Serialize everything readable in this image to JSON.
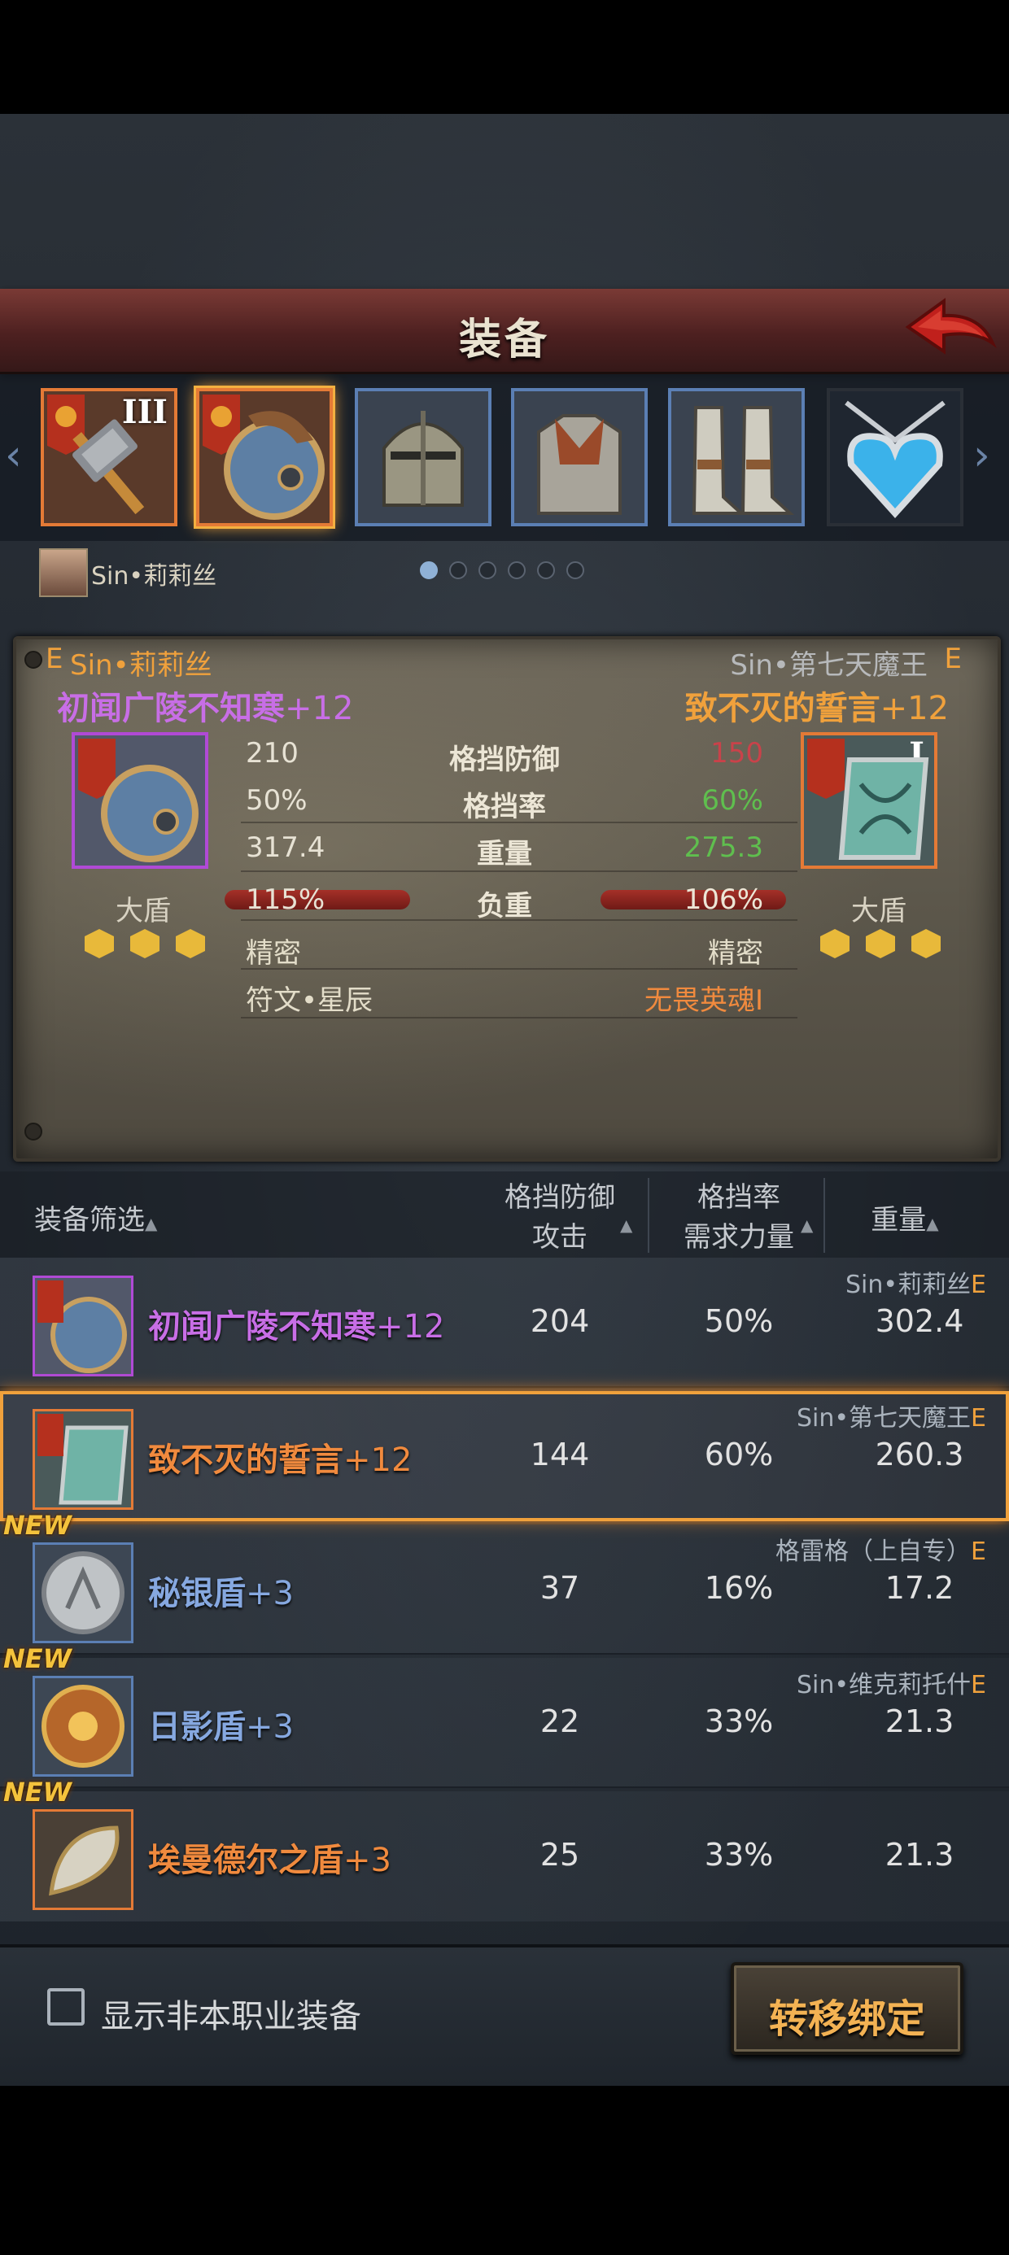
{
  "header": {
    "title": "装备"
  },
  "slots": [
    {
      "name": "hammer",
      "roman": "III"
    },
    {
      "name": "shield",
      "roman": ""
    },
    {
      "name": "helmet",
      "roman": ""
    },
    {
      "name": "armor",
      "roman": ""
    },
    {
      "name": "boots",
      "roman": ""
    },
    {
      "name": "amulet",
      "roman": ""
    }
  ],
  "character": {
    "name": "Sin•莉莉丝"
  },
  "pager": {
    "count": 6,
    "active": 0
  },
  "compare": {
    "left": {
      "grade": "E",
      "owner": "Sin•莉莉丝",
      "item": "初闻广陵不知寒",
      "plus": "+12",
      "type": "大盾",
      "block_def": "210",
      "block_rate": "50%",
      "weight": "317.4",
      "load": "115%",
      "load_value": 1.15,
      "trait": "精密",
      "rune": "符文•星辰",
      "gems": 3
    },
    "right": {
      "grade": "E",
      "owner": "Sin•第七天魔王",
      "item": "致不灭的誓言",
      "plus": "+12",
      "type": "大盾",
      "roman": "I",
      "block_def": "150",
      "block_rate": "60%",
      "weight": "275.3",
      "load": "106%",
      "load_value": 1.06,
      "trait": "精密",
      "rune": "无畏英魂I",
      "gems": 3
    },
    "labels": {
      "block_def": "格挡防御",
      "block_rate": "格挡率",
      "weight": "重量",
      "load": "负重"
    },
    "colors": {
      "worse": "#c9424a",
      "better": "#5fbf4e",
      "neutral": "#e7e2d4"
    }
  },
  "list_header": {
    "filter": "装备筛选",
    "col1_top": "格挡防御",
    "col1_bottom": "攻击",
    "col2_top": "格挡率",
    "col2_bottom": "需求力量",
    "col3": "重量"
  },
  "items": [
    {
      "name": "初闻广陵不知寒",
      "plus": "+12",
      "rarity": "purple",
      "v1": "204",
      "v2": "50%",
      "v3": "302.4",
      "owner": "Sin•莉莉丝",
      "grade": "E",
      "is_new": false,
      "new_label": "",
      "selected": false
    },
    {
      "name": "致不灭的誓言",
      "plus": "+12",
      "rarity": "orange",
      "v1": "144",
      "v2": "60%",
      "v3": "260.3",
      "owner": "Sin•第七天魔王",
      "grade": "E",
      "is_new": false,
      "new_label": "",
      "selected": true
    },
    {
      "name": "秘银盾",
      "plus": "+3",
      "rarity": "blue",
      "v1": "37",
      "v2": "16%",
      "v3": "17.2",
      "owner": "格雷格（上自专）",
      "grade": "E",
      "is_new": true,
      "new_label": "NEW",
      "selected": false
    },
    {
      "name": "日影盾",
      "plus": "+3",
      "rarity": "blue",
      "v1": "22",
      "v2": "33%",
      "v3": "21.3",
      "owner": "Sin•维克莉托什",
      "grade": "E",
      "is_new": true,
      "new_label": "NEW",
      "selected": false
    },
    {
      "name": "埃曼德尔之盾",
      "plus": "+3",
      "rarity": "orange",
      "v1": "25",
      "v2": "33%",
      "v3": "21.3",
      "owner": "",
      "grade": "",
      "is_new": true,
      "new_label": "NEW",
      "selected": false
    }
  ],
  "footer": {
    "checkbox_label": "显示非本职业装备",
    "checkbox_checked": false,
    "transfer_label": "转移绑定"
  }
}
